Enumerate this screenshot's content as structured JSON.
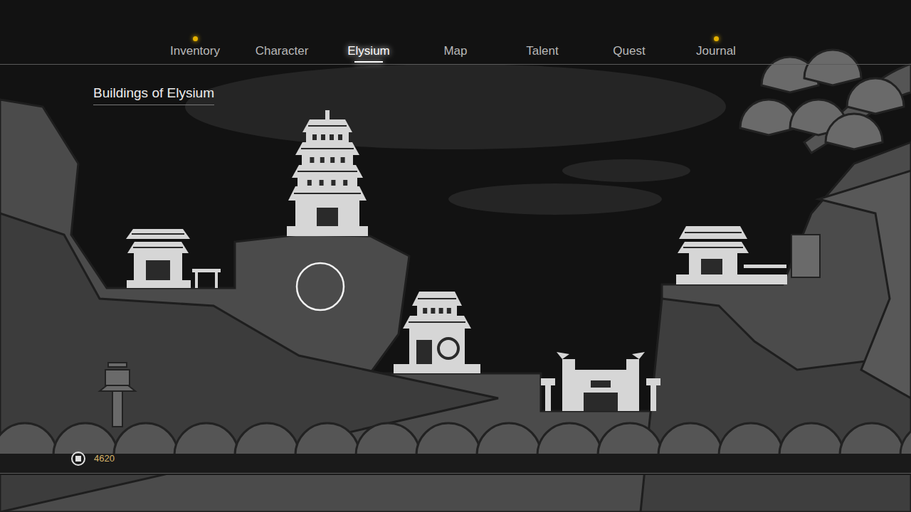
{
  "tabs": [
    {
      "label": "Inventory",
      "selected": false,
      "notify": true
    },
    {
      "label": "Character",
      "selected": false,
      "notify": false
    },
    {
      "label": "Elysium",
      "selected": true,
      "notify": false
    },
    {
      "label": "Map",
      "selected": false,
      "notify": false
    },
    {
      "label": "Talent",
      "selected": false,
      "notify": false
    },
    {
      "label": "Quest",
      "selected": false,
      "notify": false
    },
    {
      "label": "Journal",
      "selected": false,
      "notify": true
    }
  ],
  "page": {
    "title": "Buildings of Elysium"
  },
  "currency": {
    "amount": "4620"
  }
}
